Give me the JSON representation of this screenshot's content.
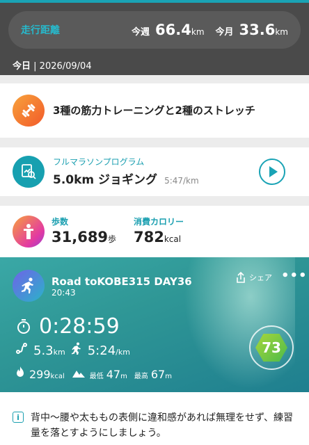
{
  "summary": {
    "distance_label": "走行距離",
    "week_label": "今週",
    "week_value": "66.4",
    "month_label": "今月",
    "month_value": "33.6",
    "unit": "km",
    "today_label": "今日",
    "today_date": "2026/09/04"
  },
  "training": {
    "title": "3種の筋力トレーニングと2種のストレッチ"
  },
  "program": {
    "subtitle": "フルマラソンプログラム",
    "title": "5.0km ジョギング",
    "pace": "5:47/km"
  },
  "steps": {
    "steps_label": "歩数",
    "steps_value": "31,689",
    "steps_unit": "歩",
    "cal_label": "消費カロリー",
    "cal_value": "782",
    "cal_unit": "kcal"
  },
  "activity": {
    "title": "Road toKOBE315 DAY36",
    "time": "20:43",
    "share_label": "シェア",
    "more": "•••",
    "duration": "0:28:59",
    "distance": "5.3",
    "distance_unit": "km",
    "pace": "5:24",
    "pace_unit": "/km",
    "calories": "299",
    "calories_unit": "kcal",
    "min_label": "最低",
    "min_value": "47",
    "max_label": "最高",
    "max_value": "67",
    "elev_unit": "m",
    "score": "73"
  },
  "advice": {
    "text": "背中〜腰や太ももの表側に違和感があれば無理をせず、練習量を落とすようにしましょう。"
  },
  "icons": [
    "dumbbell-icon",
    "report-search-icon",
    "play-icon",
    "body-icon",
    "runner-icon",
    "share-icon",
    "more-icon",
    "stopwatch-icon",
    "route-icon",
    "pace-runner-icon",
    "flame-icon",
    "mountain-icon",
    "info-icon"
  ],
  "colors": {
    "accent": "#1aa3b5",
    "header_bg": "#4a4a4a",
    "orange": "#f25a2a",
    "score_green": "#7cc63f"
  }
}
